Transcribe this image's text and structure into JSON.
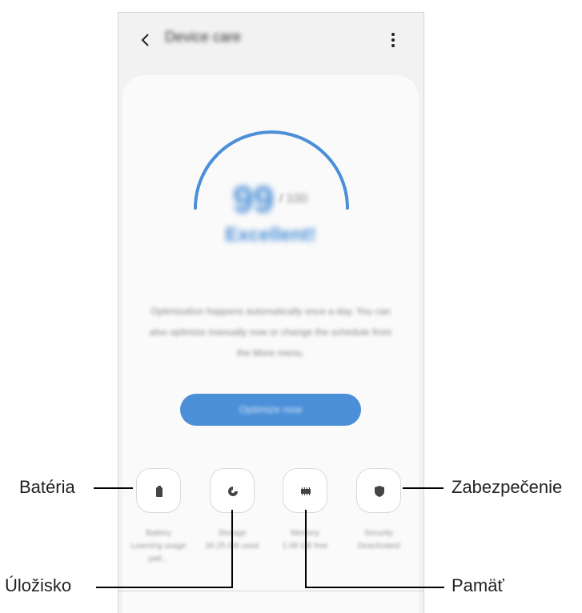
{
  "header": {
    "title": "Device care",
    "back_icon": "chevron-left-icon",
    "more_icon": "more-vertical-icon"
  },
  "score": {
    "value": "99",
    "separator": "/",
    "max": "100",
    "status": "Excellent!",
    "gauge_level": 0.99
  },
  "description": "Optimization happens automatically once a day. You can also optimize manually now or change the schedule from the More menu.",
  "optimize_button": "Optimize now",
  "tiles": [
    {
      "icon": "battery-icon",
      "title": "Battery",
      "value": "Learning usage patt..."
    },
    {
      "icon": "storage-pie-icon",
      "title": "Storage",
      "value": "30.25 GB used"
    },
    {
      "icon": "memory-chip-icon",
      "title": "Memory",
      "value": "1.08 GB free"
    },
    {
      "icon": "security-shield-icon",
      "title": "Security",
      "value": "Deactivated"
    }
  ],
  "callouts": {
    "battery": "Batéria",
    "storage": "Úložisko",
    "memory": "Pamäť",
    "security": "Zabezpečenie"
  },
  "colors": {
    "accent": "#4a8fd8",
    "background": "#f2f2f2",
    "card": "#fafafa"
  }
}
